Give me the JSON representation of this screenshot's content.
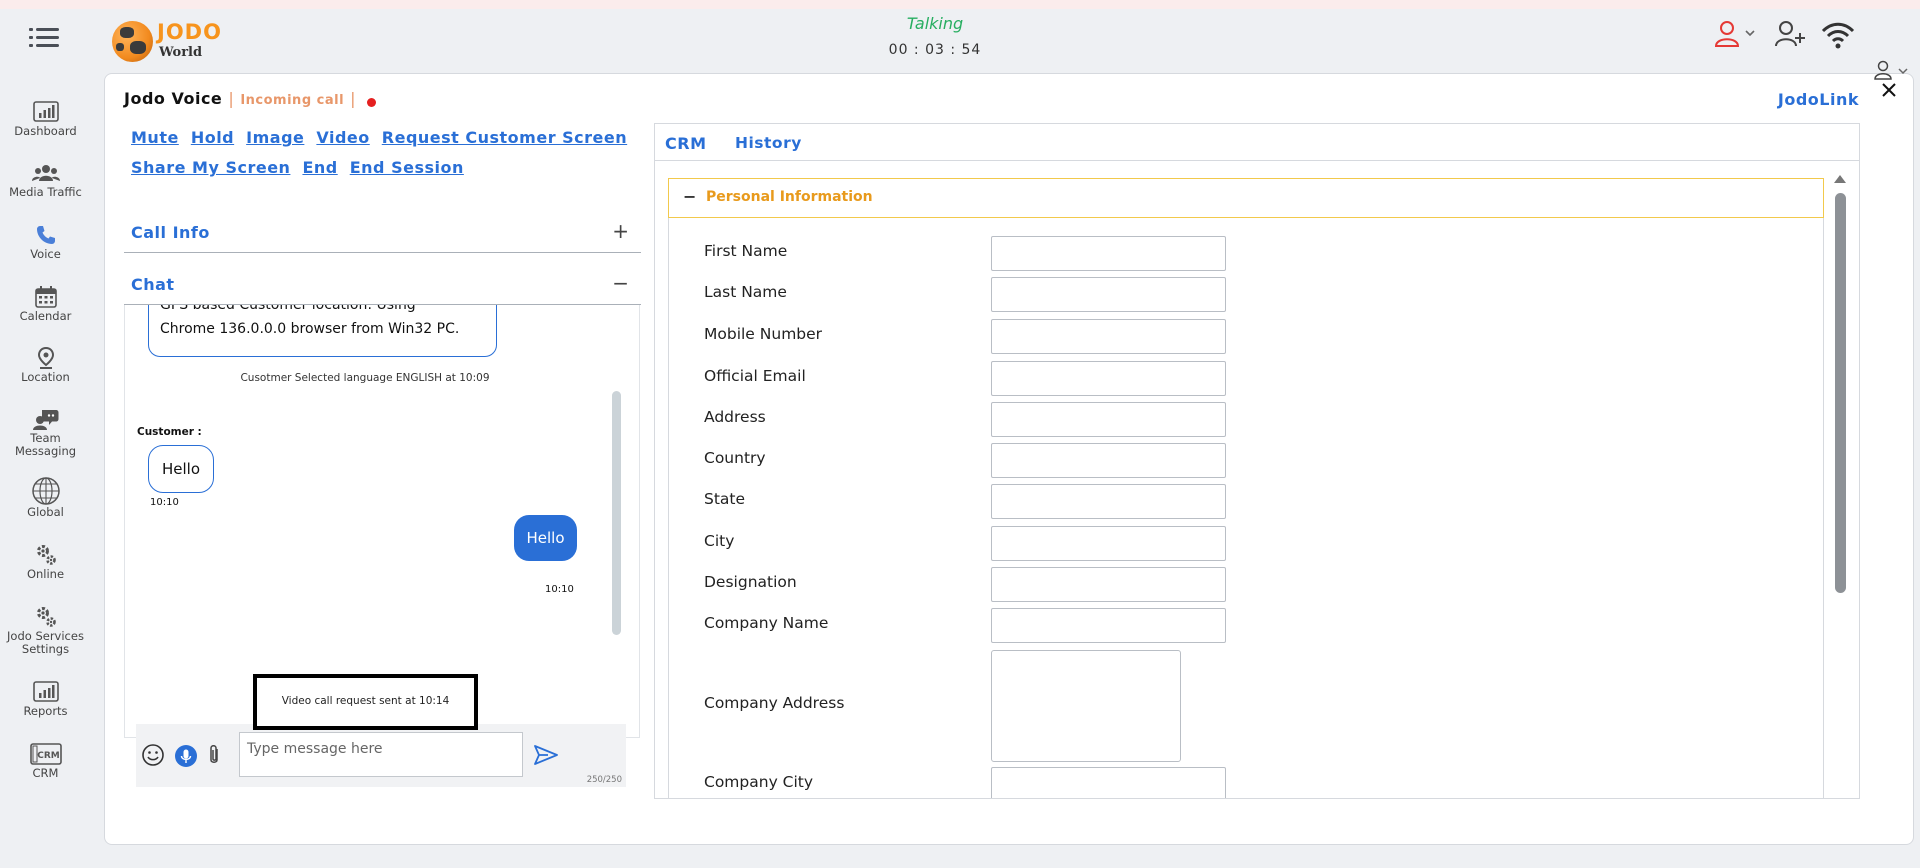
{
  "header": {
    "logo_title": "JODO",
    "logo_subtitle": "World",
    "call_status": "Talking",
    "call_timer": "00 : 03 : 54"
  },
  "colors": {
    "accent": "#2a6fd6",
    "brand_orange": "#f7941d",
    "status_green": "#27ae60",
    "alert_red": "#e52020"
  },
  "sidebar": {
    "items": [
      {
        "label": "Dashboard",
        "icon": "dashboard-icon"
      },
      {
        "label": "Media Traffic",
        "icon": "media-traffic-icon"
      },
      {
        "label": "Voice",
        "icon": "phone-icon"
      },
      {
        "label": "Calendar",
        "icon": "calendar-icon"
      },
      {
        "label": "Location",
        "icon": "location-pin-icon"
      },
      {
        "label": "Team Messaging",
        "icon": "team-messaging-icon"
      },
      {
        "label": "Global",
        "icon": "globe-icon"
      },
      {
        "label": "Online",
        "icon": "gear-icon"
      },
      {
        "label": "Jodo Services Settings",
        "icon": "gear-icon"
      },
      {
        "label": "Reports",
        "icon": "reports-icon"
      },
      {
        "label": "CRM",
        "icon": "crm-icon"
      }
    ]
  },
  "voice": {
    "title": "Jodo Voice",
    "separator": "|",
    "status": "Incoming call",
    "jodolink": "JodoLink",
    "actions": [
      "Mute",
      "Hold",
      "Image",
      "Video",
      "Request Customer Screen",
      "Share My Screen",
      "End",
      "End Session"
    ]
  },
  "accordions": {
    "call_info": {
      "label": "Call Info",
      "sign": "+"
    },
    "chat": {
      "label": "Chat",
      "sign": "−"
    }
  },
  "chat": {
    "top_bubble_line1": "GPS based Customer location: Using",
    "top_bubble_line2": "Chrome 136.0.0.0 browser from Win32 PC.",
    "language_note": "Cusotmer Selected language ENGLISH at 10:09",
    "customer_label": "Customer :",
    "customer_message": "Hello",
    "customer_time": "10:10",
    "agent_message": "Hello",
    "agent_time": "10:10",
    "video_request_note": "Video call request sent at 10:14",
    "input_placeholder": "Type message here",
    "char_count": "250/250"
  },
  "crm": {
    "tabs": [
      "CRM",
      "History"
    ],
    "section_sign": "−",
    "section_title": "Personal Information",
    "fields": [
      "First Name",
      "Last Name",
      "Mobile Number",
      "Official Email",
      "Address",
      "Country",
      "State",
      "City",
      "Designation",
      "Company Name",
      "Company Address",
      "Company City"
    ]
  }
}
